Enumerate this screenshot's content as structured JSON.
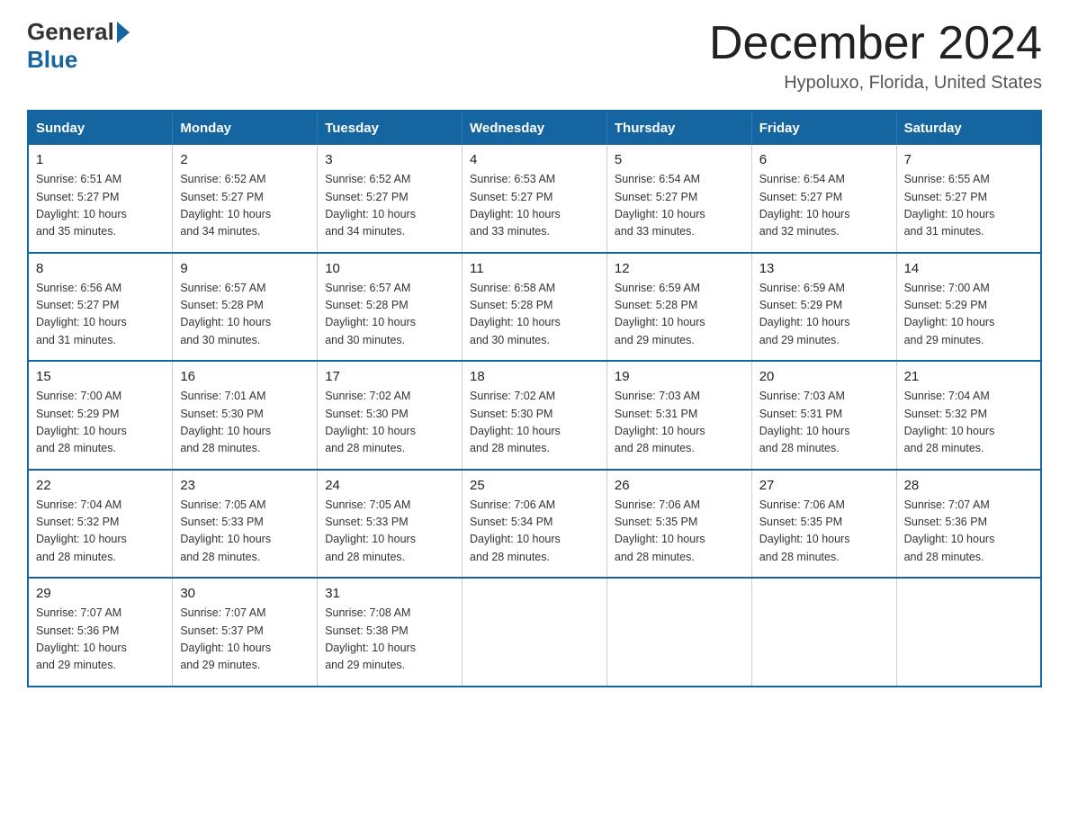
{
  "header": {
    "logo_general": "General",
    "logo_blue": "Blue",
    "month_title": "December 2024",
    "location": "Hypoluxo, Florida, United States"
  },
  "days_of_week": [
    "Sunday",
    "Monday",
    "Tuesday",
    "Wednesday",
    "Thursday",
    "Friday",
    "Saturday"
  ],
  "weeks": [
    [
      {
        "day": "1",
        "sunrise": "6:51 AM",
        "sunset": "5:27 PM",
        "daylight": "10 hours and 35 minutes."
      },
      {
        "day": "2",
        "sunrise": "6:52 AM",
        "sunset": "5:27 PM",
        "daylight": "10 hours and 34 minutes."
      },
      {
        "day": "3",
        "sunrise": "6:52 AM",
        "sunset": "5:27 PM",
        "daylight": "10 hours and 34 minutes."
      },
      {
        "day": "4",
        "sunrise": "6:53 AM",
        "sunset": "5:27 PM",
        "daylight": "10 hours and 33 minutes."
      },
      {
        "day": "5",
        "sunrise": "6:54 AM",
        "sunset": "5:27 PM",
        "daylight": "10 hours and 33 minutes."
      },
      {
        "day": "6",
        "sunrise": "6:54 AM",
        "sunset": "5:27 PM",
        "daylight": "10 hours and 32 minutes."
      },
      {
        "day": "7",
        "sunrise": "6:55 AM",
        "sunset": "5:27 PM",
        "daylight": "10 hours and 31 minutes."
      }
    ],
    [
      {
        "day": "8",
        "sunrise": "6:56 AM",
        "sunset": "5:27 PM",
        "daylight": "10 hours and 31 minutes."
      },
      {
        "day": "9",
        "sunrise": "6:57 AM",
        "sunset": "5:28 PM",
        "daylight": "10 hours and 30 minutes."
      },
      {
        "day": "10",
        "sunrise": "6:57 AM",
        "sunset": "5:28 PM",
        "daylight": "10 hours and 30 minutes."
      },
      {
        "day": "11",
        "sunrise": "6:58 AM",
        "sunset": "5:28 PM",
        "daylight": "10 hours and 30 minutes."
      },
      {
        "day": "12",
        "sunrise": "6:59 AM",
        "sunset": "5:28 PM",
        "daylight": "10 hours and 29 minutes."
      },
      {
        "day": "13",
        "sunrise": "6:59 AM",
        "sunset": "5:29 PM",
        "daylight": "10 hours and 29 minutes."
      },
      {
        "day": "14",
        "sunrise": "7:00 AM",
        "sunset": "5:29 PM",
        "daylight": "10 hours and 29 minutes."
      }
    ],
    [
      {
        "day": "15",
        "sunrise": "7:00 AM",
        "sunset": "5:29 PM",
        "daylight": "10 hours and 28 minutes."
      },
      {
        "day": "16",
        "sunrise": "7:01 AM",
        "sunset": "5:30 PM",
        "daylight": "10 hours and 28 minutes."
      },
      {
        "day": "17",
        "sunrise": "7:02 AM",
        "sunset": "5:30 PM",
        "daylight": "10 hours and 28 minutes."
      },
      {
        "day": "18",
        "sunrise": "7:02 AM",
        "sunset": "5:30 PM",
        "daylight": "10 hours and 28 minutes."
      },
      {
        "day": "19",
        "sunrise": "7:03 AM",
        "sunset": "5:31 PM",
        "daylight": "10 hours and 28 minutes."
      },
      {
        "day": "20",
        "sunrise": "7:03 AM",
        "sunset": "5:31 PM",
        "daylight": "10 hours and 28 minutes."
      },
      {
        "day": "21",
        "sunrise": "7:04 AM",
        "sunset": "5:32 PM",
        "daylight": "10 hours and 28 minutes."
      }
    ],
    [
      {
        "day": "22",
        "sunrise": "7:04 AM",
        "sunset": "5:32 PM",
        "daylight": "10 hours and 28 minutes."
      },
      {
        "day": "23",
        "sunrise": "7:05 AM",
        "sunset": "5:33 PM",
        "daylight": "10 hours and 28 minutes."
      },
      {
        "day": "24",
        "sunrise": "7:05 AM",
        "sunset": "5:33 PM",
        "daylight": "10 hours and 28 minutes."
      },
      {
        "day": "25",
        "sunrise": "7:06 AM",
        "sunset": "5:34 PM",
        "daylight": "10 hours and 28 minutes."
      },
      {
        "day": "26",
        "sunrise": "7:06 AM",
        "sunset": "5:35 PM",
        "daylight": "10 hours and 28 minutes."
      },
      {
        "day": "27",
        "sunrise": "7:06 AM",
        "sunset": "5:35 PM",
        "daylight": "10 hours and 28 minutes."
      },
      {
        "day": "28",
        "sunrise": "7:07 AM",
        "sunset": "5:36 PM",
        "daylight": "10 hours and 28 minutes."
      }
    ],
    [
      {
        "day": "29",
        "sunrise": "7:07 AM",
        "sunset": "5:36 PM",
        "daylight": "10 hours and 29 minutes."
      },
      {
        "day": "30",
        "sunrise": "7:07 AM",
        "sunset": "5:37 PM",
        "daylight": "10 hours and 29 minutes."
      },
      {
        "day": "31",
        "sunrise": "7:08 AM",
        "sunset": "5:38 PM",
        "daylight": "10 hours and 29 minutes."
      },
      null,
      null,
      null,
      null
    ]
  ],
  "labels": {
    "sunrise": "Sunrise:",
    "sunset": "Sunset:",
    "daylight": "Daylight:"
  }
}
